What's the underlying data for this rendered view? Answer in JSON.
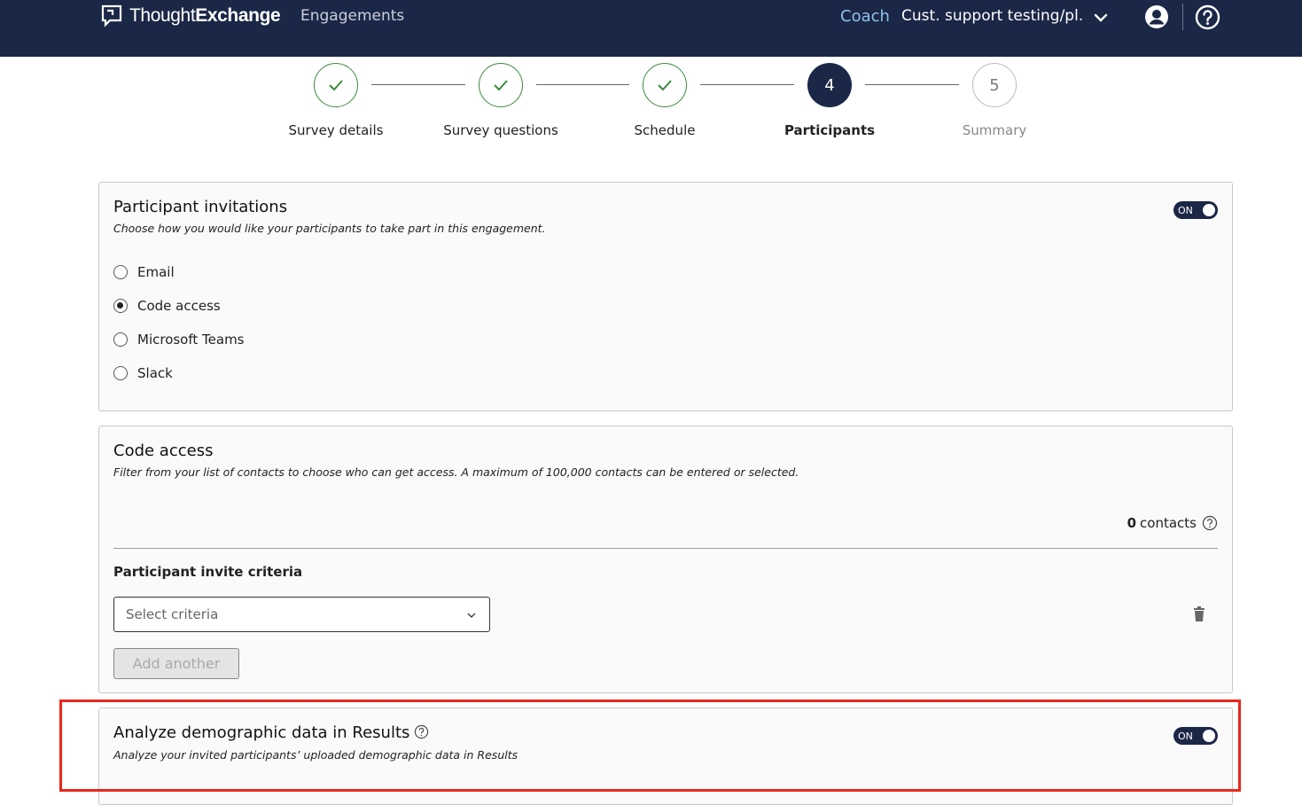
{
  "header": {
    "logo": {
      "prefix": "Thought",
      "suffix": "Exchange"
    },
    "nav_engagements": "Engagements",
    "nav_coach": "Coach",
    "org_name": "Cust. support testing/pl..."
  },
  "stepper": {
    "steps": [
      {
        "label": "Survey details",
        "state": "done"
      },
      {
        "label": "Survey questions",
        "state": "done"
      },
      {
        "label": "Schedule",
        "state": "done"
      },
      {
        "label": "Participants",
        "number": "4",
        "state": "current"
      },
      {
        "label": "Summary",
        "number": "5",
        "state": "todo"
      }
    ]
  },
  "invitations": {
    "title": "Participant invitations",
    "subtitle": "Choose how you would like your participants to take part in this engagement.",
    "toggle": "ON",
    "options": [
      {
        "label": "Email",
        "checked": false
      },
      {
        "label": "Code access",
        "checked": true
      },
      {
        "label": "Microsoft Teams",
        "checked": false
      },
      {
        "label": "Slack",
        "checked": false
      }
    ]
  },
  "code_access": {
    "title": "Code access",
    "subtitle": "Filter from your list of contacts to choose who can get access. A maximum of 100,000 contacts can be entered or selected.",
    "contacts_count": "0",
    "contacts_label": "contacts",
    "criteria_label": "Participant invite criteria",
    "select_placeholder": "Select criteria",
    "add_another": "Add another"
  },
  "demographic": {
    "title": "Analyze demographic data in Results",
    "subtitle": "Analyze your invited participants’ uploaded demographic data in Results",
    "toggle": "ON"
  },
  "colors": {
    "header_bg": "#1b2747",
    "check_green": "#3c8a3c",
    "highlight_red": "#e8291c"
  }
}
